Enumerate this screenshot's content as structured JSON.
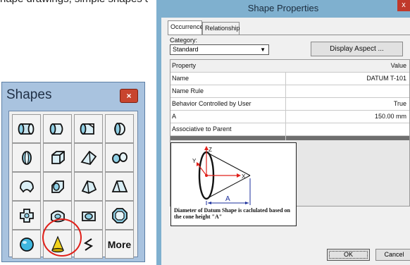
{
  "top_text": "hape drawings, simple shapes are",
  "shapes_palette": {
    "title": "Shapes",
    "close_label": "×",
    "tools": [
      {
        "icon": "cylinder-horizontal-icon"
      },
      {
        "icon": "cylinder-cut-icon"
      },
      {
        "icon": "cylinder-notch-icon"
      },
      {
        "icon": "cylinder-end-icon"
      },
      {
        "icon": "cylinder-vertical-icon"
      },
      {
        "icon": "box-icon"
      },
      {
        "icon": "wedge-icon"
      },
      {
        "icon": "elbow-icon"
      },
      {
        "icon": "torus-icon"
      },
      {
        "icon": "saddle-icon"
      },
      {
        "icon": "pyramid-icon"
      },
      {
        "icon": "transition-icon"
      },
      {
        "icon": "cross-icon"
      },
      {
        "icon": "dish-icon"
      },
      {
        "icon": "tee-icon"
      },
      {
        "icon": "octagon-icon"
      },
      {
        "icon": "sphere-icon"
      },
      {
        "icon": "cone-icon"
      },
      {
        "icon": "zigzag-icon"
      },
      {
        "icon": "more-icon"
      }
    ],
    "more_label": "More",
    "highlight_color": "#e0201a"
  },
  "dialog": {
    "title": "Shape Properties",
    "close_label": "x",
    "tabs": [
      "Occurrence",
      "Relationship"
    ],
    "category_label": "Category:",
    "category_value": "Standard",
    "display_aspect_button": "Display Aspect ...",
    "grid": {
      "header": {
        "property": "Property",
        "value": "Value"
      },
      "rows": [
        {
          "property": "Name",
          "value": "DATUM T-101"
        },
        {
          "property": "Name Rule",
          "value": ""
        },
        {
          "property": "Behavior Controlled by User",
          "value": "True"
        },
        {
          "property": "A",
          "value": "150.00 mm"
        },
        {
          "property": "Associative to Parent",
          "value": ""
        }
      ]
    },
    "diagram": {
      "axis_z": "Z",
      "axis_y": "Y",
      "axis_x": "X",
      "dim_label": "A",
      "caption": "Diameter of Datum Shape is caclulated based on the cone height \"A\""
    },
    "ok_button": "OK",
    "cancel_button": "Cancel"
  }
}
